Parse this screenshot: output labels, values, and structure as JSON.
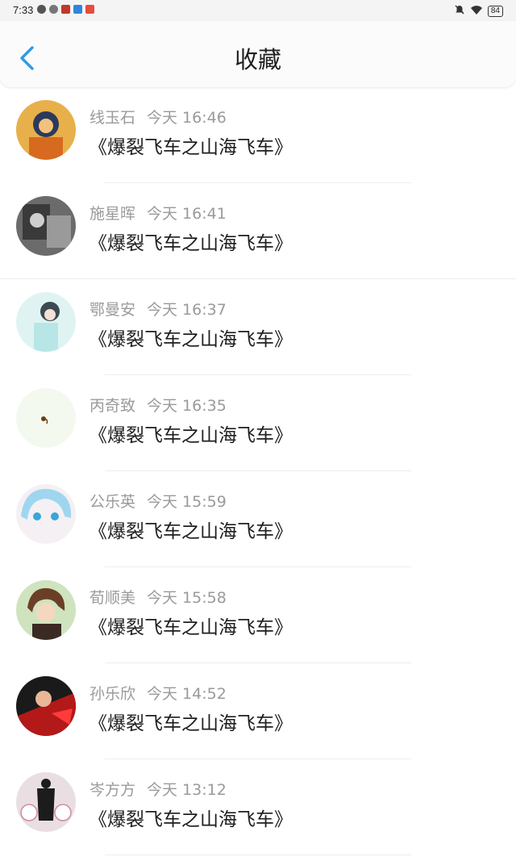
{
  "status_bar": {
    "time": "7:33",
    "battery": "84"
  },
  "header": {
    "title": "收藏"
  },
  "items": [
    {
      "name": "线玉石",
      "time": "今天 16:46",
      "content": "《爆裂飞车之山海飞车》",
      "avatar_color": "#c98a2e"
    },
    {
      "name": "施星晖",
      "time": "今天 16:41",
      "content": "《爆裂飞车之山海飞车》",
      "avatar_color": "#4a4a4a"
    },
    {
      "name": "鄂曼安",
      "time": "今天 16:37",
      "content": "《爆裂飞车之山海飞车》",
      "avatar_color": "#cfeff0"
    },
    {
      "name": "丙奇致",
      "time": "今天 16:35",
      "content": "《爆裂飞车之山海飞车》",
      "avatar_color": "#f2f8ee"
    },
    {
      "name": "公乐英",
      "time": "今天 15:59",
      "content": "《爆裂飞车之山海飞车》",
      "avatar_color": "#bfe3f3"
    },
    {
      "name": "荀顺美",
      "time": "今天 15:58",
      "content": "《爆裂飞车之山海飞车》",
      "avatar_color": "#b9d3a8"
    },
    {
      "name": "孙乐欣",
      "time": "今天 14:52",
      "content": "《爆裂飞车之山海飞车》",
      "avatar_color": "#7a1b1b"
    },
    {
      "name": "岑方方",
      "time": "今天 13:12",
      "content": "《爆裂飞车之山海飞车》",
      "avatar_color": "#d9c8cf"
    }
  ],
  "colors": {
    "accent": "#2e9ae8",
    "text_primary": "#1e1e1e",
    "text_secondary": "#9a9a9a"
  }
}
